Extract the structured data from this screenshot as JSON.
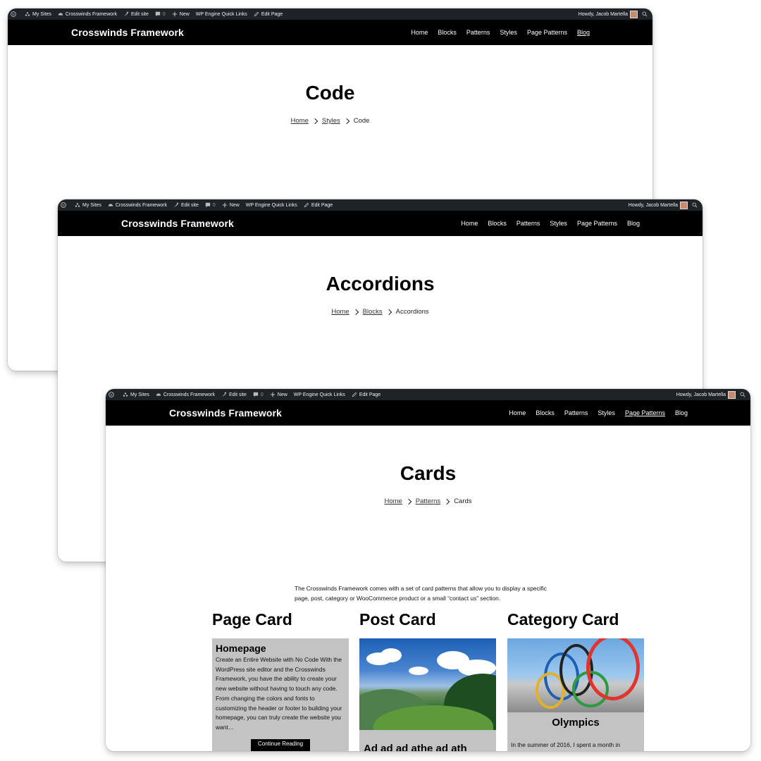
{
  "admin_bar": {
    "my_sites": "My Sites",
    "site_name": "Crosswinds Framework",
    "edit_site": "Edit site",
    "comments_count": "0",
    "new": "New",
    "quick_links": "WP Engine Quick Links",
    "edit_page": "Edit Page",
    "howdy": "Howdy, Jacob Martella"
  },
  "site_title": "Crosswinds Framework",
  "nav": [
    "Home",
    "Blocks",
    "Patterns",
    "Styles",
    "Page Patterns",
    "Blog"
  ],
  "windows": [
    {
      "title": "Code",
      "current_nav": "Blog",
      "breadcrumb": {
        "home": "Home",
        "parent": "Styles",
        "current": "Code"
      }
    },
    {
      "title": "Accordions",
      "current_nav": "",
      "breadcrumb": {
        "home": "Home",
        "parent": "Blocks",
        "current": "Accordions"
      }
    },
    {
      "title": "Cards",
      "current_nav": "Page Patterns",
      "breadcrumb": {
        "home": "Home",
        "parent": "Patterns",
        "current": "Cards"
      },
      "intro": "The Crosswinds Framework comes with a set of card patterns that allow you to display a specific page, post, category or WooCommerce product or a small “contact us” section.",
      "columns": {
        "page_card": {
          "heading": "Page Card",
          "card_title": "Homepage",
          "card_text": "Create an Entire Website with No Code With the WordPress site editor and the Crosswinds Framework, you have the ability to create your new website without having to touch any code. From changing the colors and fonts to customizing the header or footer to building your homepage, you can truly create the website you want…",
          "button": "Continue Reading"
        },
        "post_card": {
          "heading": "Post Card",
          "card_title": "Ad ad ad athe ad ath"
        },
        "category_card": {
          "heading": "Category Card",
          "card_title": "Olympics",
          "card_text": "In the summer of 2016, I spent a month in"
        }
      }
    }
  ],
  "colors": {
    "admin_bar_bg": "#1d2327",
    "header_bg": "#000000",
    "card_bg": "#c3c3c3"
  },
  "icons": [
    "wordpress-logo-icon",
    "my-sites-icon",
    "dashboard-icon",
    "edit-site-icon",
    "comment-icon",
    "plus-icon",
    "pencil-icon",
    "search-icon"
  ]
}
